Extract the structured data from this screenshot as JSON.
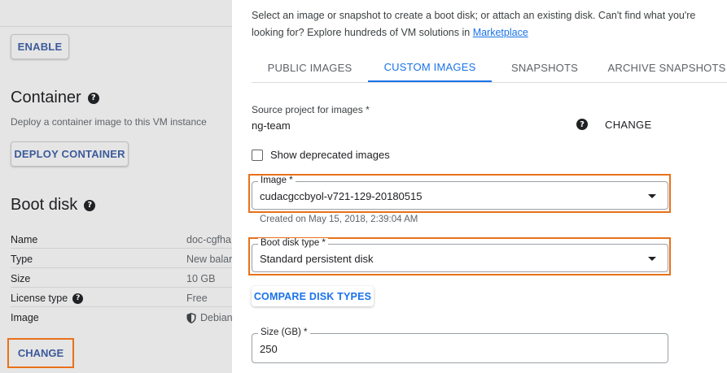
{
  "left": {
    "enable_label": "ENABLE",
    "container_title": "Container",
    "container_desc": "Deploy a container image to this VM instance",
    "deploy_label": "DEPLOY CONTAINER",
    "boot_title": "Boot disk",
    "details": [
      {
        "key": "Name",
        "value": "doc-cgfha"
      },
      {
        "key": "Type",
        "value": "New balar"
      },
      {
        "key": "Size",
        "value": "10 GB"
      },
      {
        "key": "License type",
        "value": "Free"
      },
      {
        "key": "Image",
        "value": "Debian"
      }
    ],
    "change_label": "CHANGE",
    "help_glyph": "?"
  },
  "panel": {
    "intro_text": "Select an image or snapshot to create a boot disk; or attach an existing disk. Can't find what you're looking for? Explore hundreds of VM solutions in ",
    "intro_link": "Marketplace",
    "tabs": [
      {
        "label": "PUBLIC IMAGES",
        "active": false
      },
      {
        "label": "CUSTOM IMAGES",
        "active": true
      },
      {
        "label": "SNAPSHOTS",
        "active": false
      },
      {
        "label": "ARCHIVE SNAPSHOTS",
        "active": false
      }
    ],
    "source_project_label": "Source project for images *",
    "source_project_value": "ng-team",
    "change_label": "CHANGE",
    "deprecated_label": "Show deprecated images",
    "deprecated_checked": false,
    "image_field": {
      "label": "Image *",
      "value": "cudacgccbyol-v721-129-20180515"
    },
    "created_hint": "Created on May 15, 2018, 2:39:04 AM",
    "disk_type_field": {
      "label": "Boot disk type *",
      "value": "Standard persistent disk"
    },
    "compare_label": "COMPARE DISK TYPES",
    "size_field": {
      "label": "Size (GB) *",
      "value": "250"
    }
  },
  "colors": {
    "accent": "#1a73e8",
    "highlight": "#e8711a",
    "link_dim": "#3c5a9a"
  }
}
